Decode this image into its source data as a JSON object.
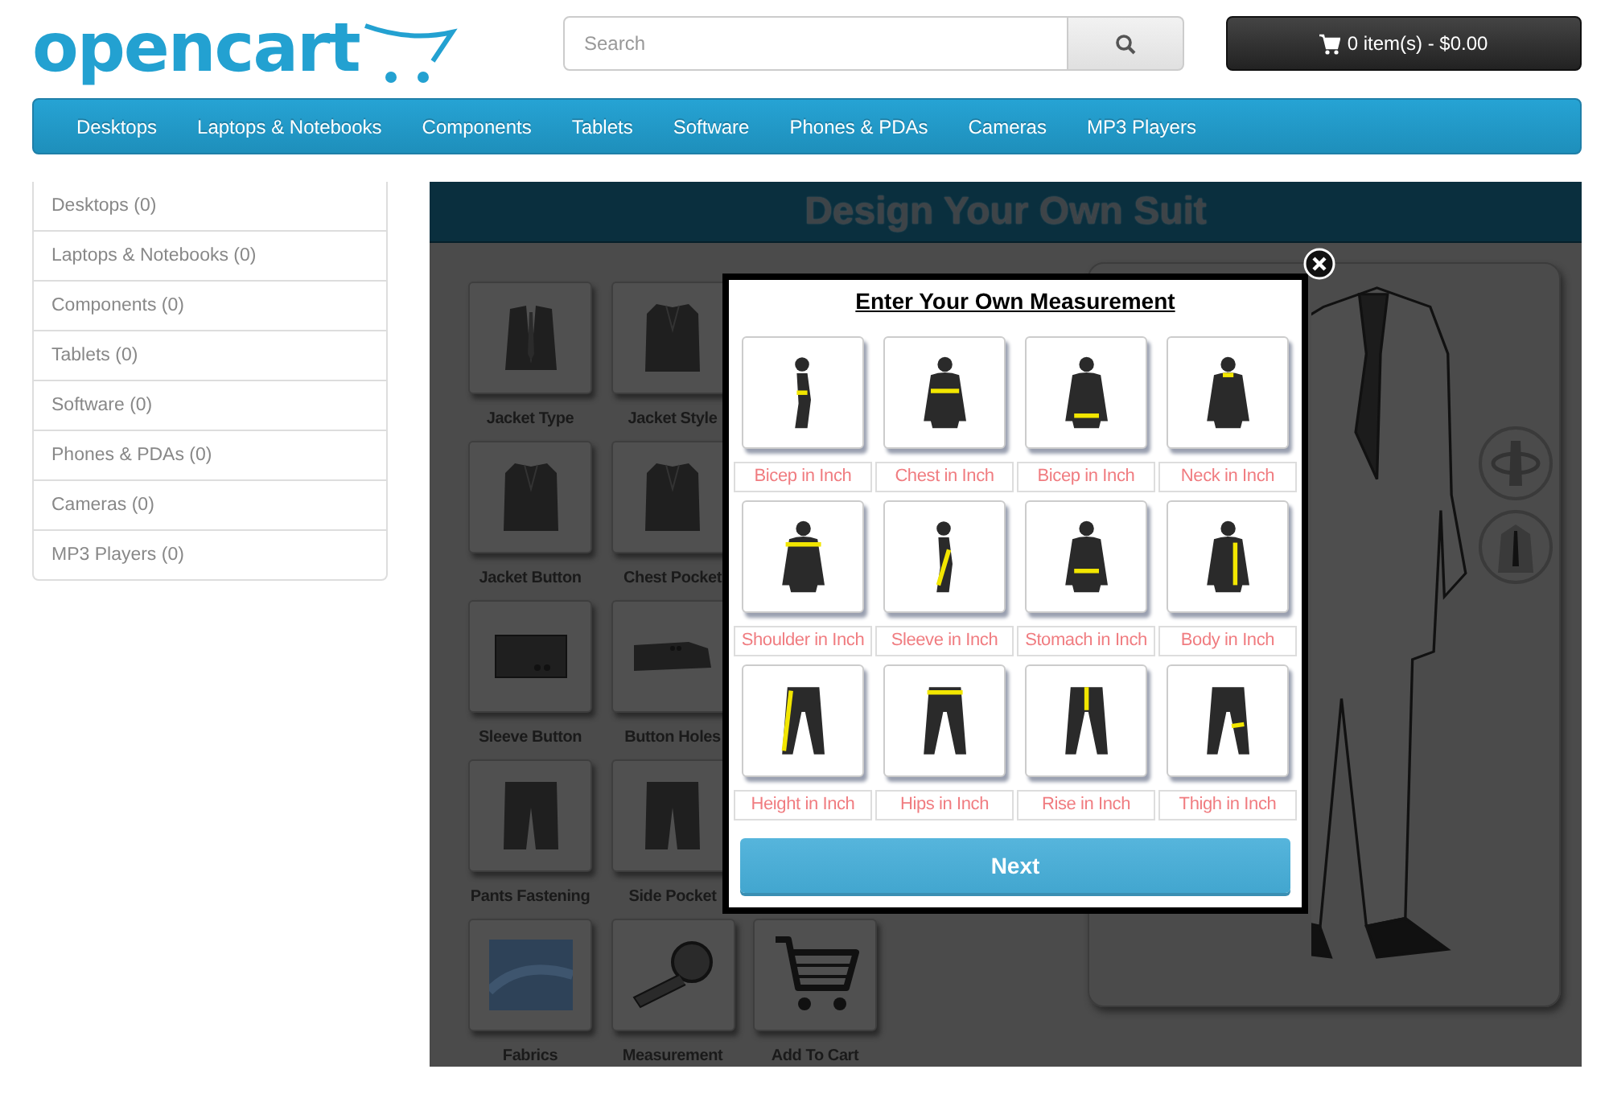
{
  "header": {
    "logo": "opencart",
    "search": {
      "placeholder": "Search"
    },
    "cart": "0 item(s) - $0.00"
  },
  "nav": [
    "Desktops",
    "Laptops & Notebooks",
    "Components",
    "Tablets",
    "Software",
    "Phones & PDAs",
    "Cameras",
    "MP3 Players"
  ],
  "sidebar": [
    "Desktops (0)",
    "Laptops & Notebooks (0)",
    "Components (0)",
    "Tablets (0)",
    "Software (0)",
    "Phones & PDAs (0)",
    "Cameras (0)",
    "MP3 Players (0)"
  ],
  "designer": {
    "title": "Design Your Own Suit",
    "options": [
      {
        "label": "Jacket Type",
        "kind": "vest"
      },
      {
        "label": "Jacket Style",
        "kind": "jacket"
      },
      {
        "label": "Jacket Button",
        "kind": "jacket"
      },
      {
        "label": "Chest Pocket",
        "kind": "jacket"
      },
      {
        "label": "Sleeve Button",
        "kind": "cuff"
      },
      {
        "label": "Button Holes",
        "kind": "sleeve"
      },
      {
        "label": "Pants Fastening",
        "kind": "trousers"
      },
      {
        "label": "Side Pocket",
        "kind": "trousers"
      },
      {
        "label": "Fabrics",
        "kind": "fabric"
      },
      {
        "label": "Measurement",
        "kind": "tape"
      },
      {
        "label": "Add To Cart",
        "kind": "cart"
      }
    ]
  },
  "modal": {
    "title": "Enter Your Own Measurement",
    "measurements": [
      {
        "label": "Bicep in Inch",
        "kind": "bicep"
      },
      {
        "label": "Chest in Inch",
        "kind": "chest"
      },
      {
        "label": "Bicep in Inch",
        "kind": "waist"
      },
      {
        "label": "Neck in Inch",
        "kind": "neck"
      },
      {
        "label": "Shoulder in Inch",
        "kind": "shoulder"
      },
      {
        "label": "Sleeve in Inch",
        "kind": "sleeve"
      },
      {
        "label": "Stomach in Inch",
        "kind": "stomach"
      },
      {
        "label": "Body in Inch",
        "kind": "body"
      },
      {
        "label": "Height in Inch",
        "kind": "height"
      },
      {
        "label": "Hips in Inch",
        "kind": "hips"
      },
      {
        "label": "Rise in Inch",
        "kind": "rise"
      },
      {
        "label": "Thigh in Inch",
        "kind": "thigh"
      }
    ],
    "next": "Next"
  }
}
